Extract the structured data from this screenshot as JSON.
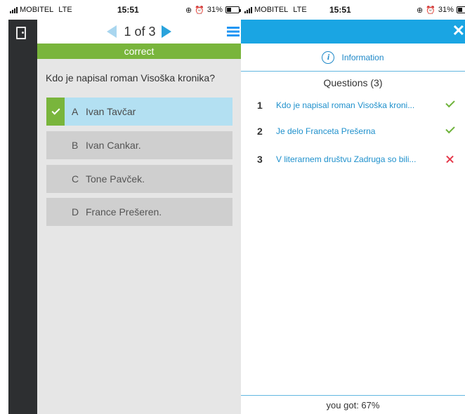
{
  "left_screen": {
    "status": {
      "carrier": "MOBITEL",
      "network": "LTE",
      "time": "15:51",
      "battery": "31%"
    },
    "header": {
      "counter": "1 of 3"
    },
    "result_label": "correct",
    "question": "Kdo je napisal roman Visoška kronika?",
    "options": [
      {
        "letter": "A",
        "text": "Ivan Tavčar",
        "selected": true
      },
      {
        "letter": "B",
        "text": "Ivan Cankar.",
        "selected": false
      },
      {
        "letter": "C",
        "text": "Tone Pavček.",
        "selected": false
      },
      {
        "letter": "D",
        "text": "France Prešeren.",
        "selected": false
      }
    ]
  },
  "right_screen": {
    "status": {
      "carrier": "MOBITEL",
      "network": "LTE",
      "time": "15:51",
      "battery": "31%"
    },
    "close_label": "✕",
    "info_label": "Information",
    "questions_title": "Questions (3)",
    "questions": [
      {
        "number": "1",
        "text": "Kdo je napisal roman Visoška kroni...",
        "status": "correct"
      },
      {
        "number": "2",
        "text": "Je delo Franceta Prešerna",
        "status": "correct"
      },
      {
        "number": "3",
        "text": "V literarnem društvu Zadruga so bili...",
        "status": "wrong"
      }
    ],
    "footer": "you got: 67%"
  },
  "colors": {
    "accent": "#1aa5e3",
    "correct": "#79b53c",
    "wrong": "#e5384a",
    "rail": "#2d2f31"
  }
}
